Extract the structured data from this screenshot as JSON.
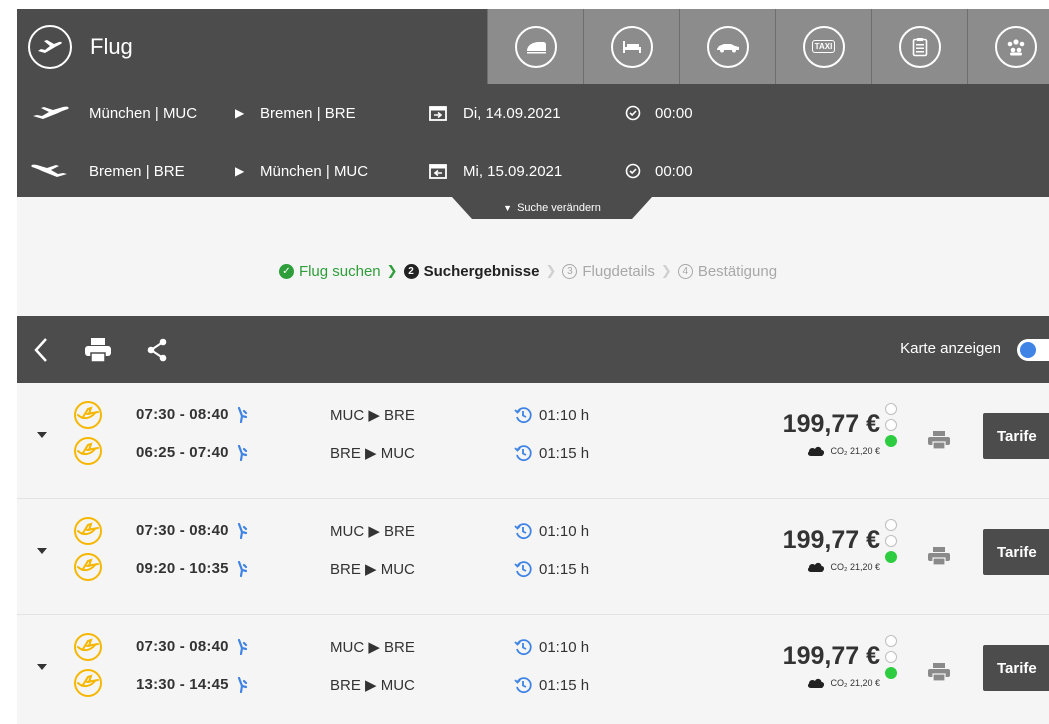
{
  "header": {
    "title": "Flug",
    "colors": {
      "header_bg": "#4c4c4c",
      "tab_bg": "#8c8c8c",
      "accent_green": "#2e9e3a",
      "lufthansa_yellow": "#f5b700"
    },
    "mode_tabs": [
      {
        "icon": "train-icon"
      },
      {
        "icon": "hotel-bed-icon"
      },
      {
        "icon": "car-icon"
      },
      {
        "icon": "taxi-icon",
        "label": "TAXI"
      },
      {
        "icon": "clipboard-icon"
      },
      {
        "icon": "group-icon"
      }
    ],
    "outbound": {
      "from": "München | MUC",
      "to": "Bremen | BRE",
      "date": "Di, 14.09.2021",
      "time": "00:00"
    },
    "return": {
      "from": "Bremen | BRE",
      "to": "München | MUC",
      "date": "Mi, 15.09.2021",
      "time": "00:00"
    },
    "search_change": "Suche verändern"
  },
  "steps": [
    {
      "num": "",
      "label": "Flug suchen",
      "state": "done"
    },
    {
      "num": "2",
      "label": "Suchergebnisse",
      "state": "active"
    },
    {
      "num": "3",
      "label": "Flugdetails",
      "state": "pending"
    },
    {
      "num": "4",
      "label": "Bestätigung",
      "state": "pending"
    }
  ],
  "toolbar": {
    "map_label": "Karte anzeigen"
  },
  "results": [
    {
      "out": {
        "time": "07:30 - 08:40",
        "route": "MUC ▶ BRE",
        "duration": "01:10 h"
      },
      "ret": {
        "time": "06:25 - 07:40",
        "route": "BRE  ▶ MUC",
        "duration": "01:15 h"
      },
      "price": "199,77 €",
      "co2": "CO₂ 21,20 €",
      "tariff_label": "Tarife"
    },
    {
      "out": {
        "time": "07:30 - 08:40",
        "route": "MUC ▶ BRE",
        "duration": "01:10 h"
      },
      "ret": {
        "time": "09:20 - 10:35",
        "route": "BRE  ▶ MUC",
        "duration": "01:15 h"
      },
      "price": "199,77 €",
      "co2": "CO₂ 21,20 €",
      "tariff_label": "Tarife"
    },
    {
      "out": {
        "time": "07:30 - 08:40",
        "route": "MUC ▶ BRE",
        "duration": "01:10 h"
      },
      "ret": {
        "time": "13:30 - 14:45",
        "route": "BRE  ▶ MUC",
        "duration": "01:15 h"
      },
      "price": "199,77 €",
      "co2": "CO₂ 21,20 €",
      "tariff_label": "Tarife"
    }
  ]
}
